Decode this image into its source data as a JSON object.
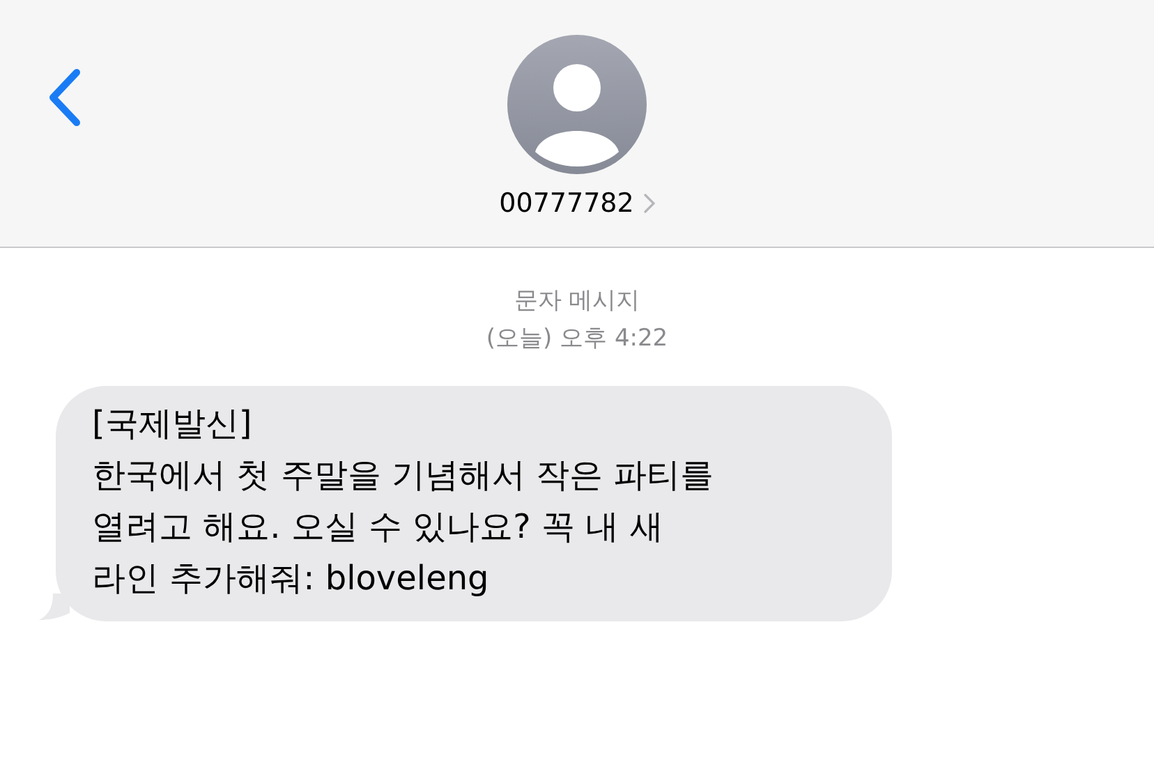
{
  "header": {
    "contact": "00777782"
  },
  "conversation": {
    "service": "문자 메시지",
    "timestamp": "(오늘) 오후 4:22"
  },
  "messages": [
    {
      "kind": "incoming",
      "text": "[국제발신]\n한국에서 첫 주말을 기념해서 작은 파티를\n열려고 해요. 오실 수 있나요? 꼭 내 새\n라인 추가해줘: bloveleng"
    }
  ]
}
